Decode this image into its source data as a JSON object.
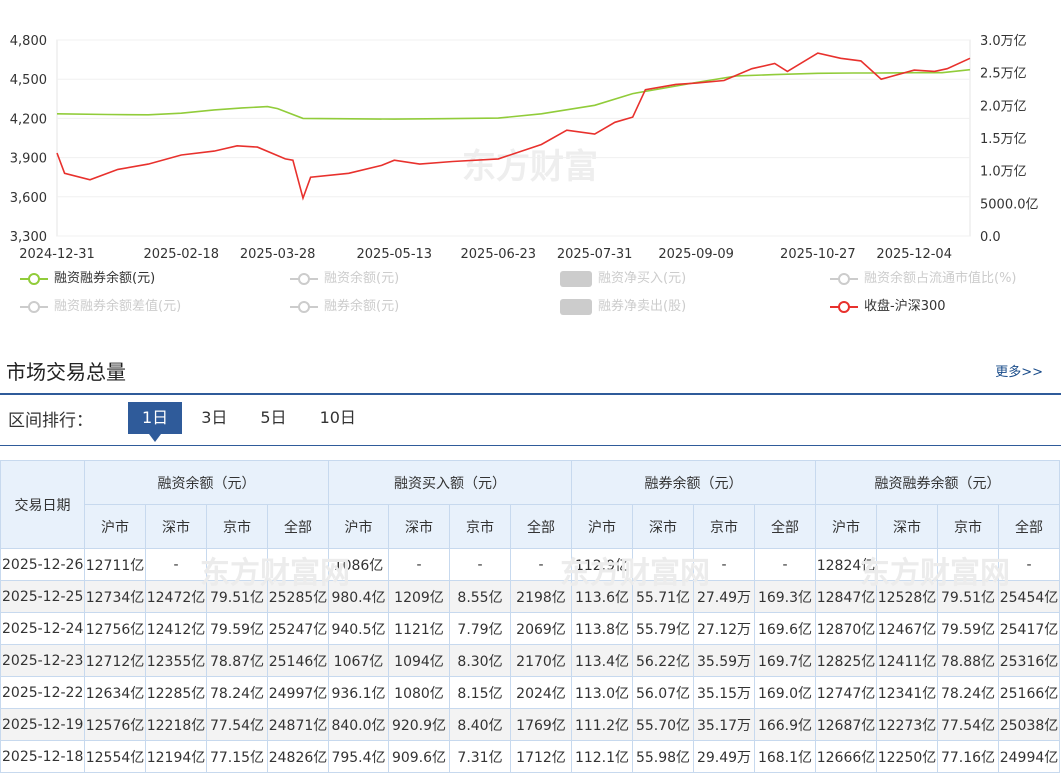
{
  "chart_data": {
    "type": "line",
    "watermark": "东方财富",
    "x_ticks": [
      "2024-12-31",
      "2025-02-18",
      "2025-03-28",
      "2025-05-13",
      "2025-06-23",
      "2025-07-31",
      "2025-09-09",
      "2025-10-27",
      "2025-12-04"
    ],
    "left_axis_ticks": [
      "4,800",
      "4,500",
      "4,200",
      "3,900",
      "3,600",
      "3,300"
    ],
    "right_axis_ticks": [
      "3.0万亿",
      "2.5万亿",
      "2.0万亿",
      "1.5万亿",
      "1.0万亿",
      "5000.0亿",
      "0.0"
    ],
    "ylim_left": [
      3300,
      4800
    ],
    "ylim_right": [
      0,
      30000
    ],
    "x_range": [
      "2024-12-31",
      "2025-12-26"
    ],
    "series": [
      {
        "name": "融资融券余额(元)",
        "axis": "right",
        "unit": "亿",
        "color": "#91cc3a",
        "x": [
          "2024-12-31",
          "2025-01-20",
          "2025-02-05",
          "2025-02-18",
          "2025-03-03",
          "2025-03-14",
          "2025-03-24",
          "2025-03-28",
          "2025-04-07",
          "2025-04-20",
          "2025-05-13",
          "2025-06-01",
          "2025-06-23",
          "2025-07-10",
          "2025-07-31",
          "2025-08-15",
          "2025-09-09",
          "2025-09-25",
          "2025-10-10",
          "2025-10-27",
          "2025-11-10",
          "2025-11-20",
          "2025-12-04",
          "2025-12-15",
          "2025-12-26"
        ],
        "y": [
          18700,
          18600,
          18550,
          18800,
          19300,
          19600,
          19800,
          19500,
          18000,
          17950,
          17900,
          17950,
          18050,
          18700,
          20000,
          21800,
          23500,
          24500,
          24700,
          24900,
          24950,
          24950,
          25000,
          25000,
          25450
        ]
      },
      {
        "name": "收盘-沪深300",
        "axis": "left",
        "color": "#e8312d",
        "x": [
          "2024-12-31",
          "2025-01-03",
          "2025-01-13",
          "2025-01-24",
          "2025-02-05",
          "2025-02-18",
          "2025-03-03",
          "2025-03-12",
          "2025-03-20",
          "2025-03-31",
          "2025-04-03",
          "2025-04-07",
          "2025-04-10",
          "2025-04-25",
          "2025-05-08",
          "2025-05-13",
          "2025-05-23",
          "2025-06-05",
          "2025-06-23",
          "2025-07-10",
          "2025-07-20",
          "2025-07-31",
          "2025-08-08",
          "2025-08-15",
          "2025-08-20",
          "2025-09-01",
          "2025-09-09",
          "2025-09-20",
          "2025-10-01",
          "2025-10-10",
          "2025-10-15",
          "2025-10-27",
          "2025-11-05",
          "2025-11-13",
          "2025-11-21",
          "2025-12-04",
          "2025-12-12",
          "2025-12-17",
          "2025-12-26"
        ],
        "y": [
          3935,
          3780,
          3730,
          3810,
          3850,
          3920,
          3950,
          3990,
          3980,
          3890,
          3880,
          3590,
          3750,
          3780,
          3840,
          3880,
          3850,
          3870,
          3890,
          4000,
          4110,
          4080,
          4170,
          4210,
          4420,
          4460,
          4470,
          4490,
          4580,
          4620,
          4560,
          4700,
          4660,
          4640,
          4500,
          4570,
          4560,
          4580,
          4660
        ]
      }
    ]
  },
  "legend": [
    {
      "label": "融资融券余额(元)",
      "color": "#91cc3a",
      "style": "line",
      "active": true
    },
    {
      "label": "融资余额(元)",
      "color": "#cccccc",
      "style": "line",
      "active": false
    },
    {
      "label": "融资净买入(元)",
      "color": "#cccccc",
      "style": "box",
      "active": false
    },
    {
      "label": "融资余额占流通市值比(%)",
      "color": "#cccccc",
      "style": "line",
      "active": false
    },
    {
      "label": "融资融券余额差值(元)",
      "color": "#cccccc",
      "style": "line",
      "active": false
    },
    {
      "label": "融券余额(元)",
      "color": "#cccccc",
      "style": "line",
      "active": false
    },
    {
      "label": "融券净卖出(股)",
      "color": "#cccccc",
      "style": "box",
      "active": false
    },
    {
      "label": "收盘-沪深300",
      "color": "#e8312d",
      "style": "line",
      "active": true
    }
  ],
  "section": {
    "title": "市场交易总量",
    "more": "更多>>"
  },
  "range": {
    "label": "区间排行：",
    "tabs": [
      "1日",
      "3日",
      "5日",
      "10日"
    ],
    "active": 0
  },
  "table": {
    "date_header": "交易日期",
    "groups": [
      "融资余额（元）",
      "融资买入额（元）",
      "融券余额（元）",
      "融资融券余额（元）"
    ],
    "subheaders": [
      "沪市",
      "深市",
      "京市",
      "全部"
    ],
    "watermark": "东方财富网",
    "rows": [
      [
        "2025-12-26",
        "12711亿",
        "-",
        "-",
        "-",
        "1086亿",
        "-",
        "-",
        "-",
        "112.9亿",
        "-",
        "-",
        "-",
        "12824亿",
        "-",
        "-",
        "-"
      ],
      [
        "2025-12-25",
        "12734亿",
        "12472亿",
        "79.51亿",
        "25285亿",
        "980.4亿",
        "1209亿",
        "8.55亿",
        "2198亿",
        "113.6亿",
        "55.71亿",
        "27.49万",
        "169.3亿",
        "12847亿",
        "12528亿",
        "79.51亿",
        "25454亿"
      ],
      [
        "2025-12-24",
        "12756亿",
        "12412亿",
        "79.59亿",
        "25247亿",
        "940.5亿",
        "1121亿",
        "7.79亿",
        "2069亿",
        "113.8亿",
        "55.79亿",
        "27.12万",
        "169.6亿",
        "12870亿",
        "12467亿",
        "79.59亿",
        "25417亿"
      ],
      [
        "2025-12-23",
        "12712亿",
        "12355亿",
        "78.87亿",
        "25146亿",
        "1067亿",
        "1094亿",
        "8.30亿",
        "2170亿",
        "113.4亿",
        "56.22亿",
        "35.59万",
        "169.7亿",
        "12825亿",
        "12411亿",
        "78.88亿",
        "25316亿"
      ],
      [
        "2025-12-22",
        "12634亿",
        "12285亿",
        "78.24亿",
        "24997亿",
        "936.1亿",
        "1080亿",
        "8.15亿",
        "2024亿",
        "113.0亿",
        "56.07亿",
        "35.15万",
        "169.0亿",
        "12747亿",
        "12341亿",
        "78.24亿",
        "25166亿"
      ],
      [
        "2025-12-19",
        "12576亿",
        "12218亿",
        "77.54亿",
        "24871亿",
        "840.0亿",
        "920.9亿",
        "8.40亿",
        "1769亿",
        "111.2亿",
        "55.70亿",
        "35.17万",
        "166.9亿",
        "12687亿",
        "12273亿",
        "77.54亿",
        "25038亿"
      ],
      [
        "2025-12-18",
        "12554亿",
        "12194亿",
        "77.15亿",
        "24826亿",
        "795.4亿",
        "909.6亿",
        "7.31亿",
        "1712亿",
        "112.1亿",
        "55.98亿",
        "29.49万",
        "168.1亿",
        "12666亿",
        "12250亿",
        "77.16亿",
        "24994亿"
      ]
    ]
  }
}
